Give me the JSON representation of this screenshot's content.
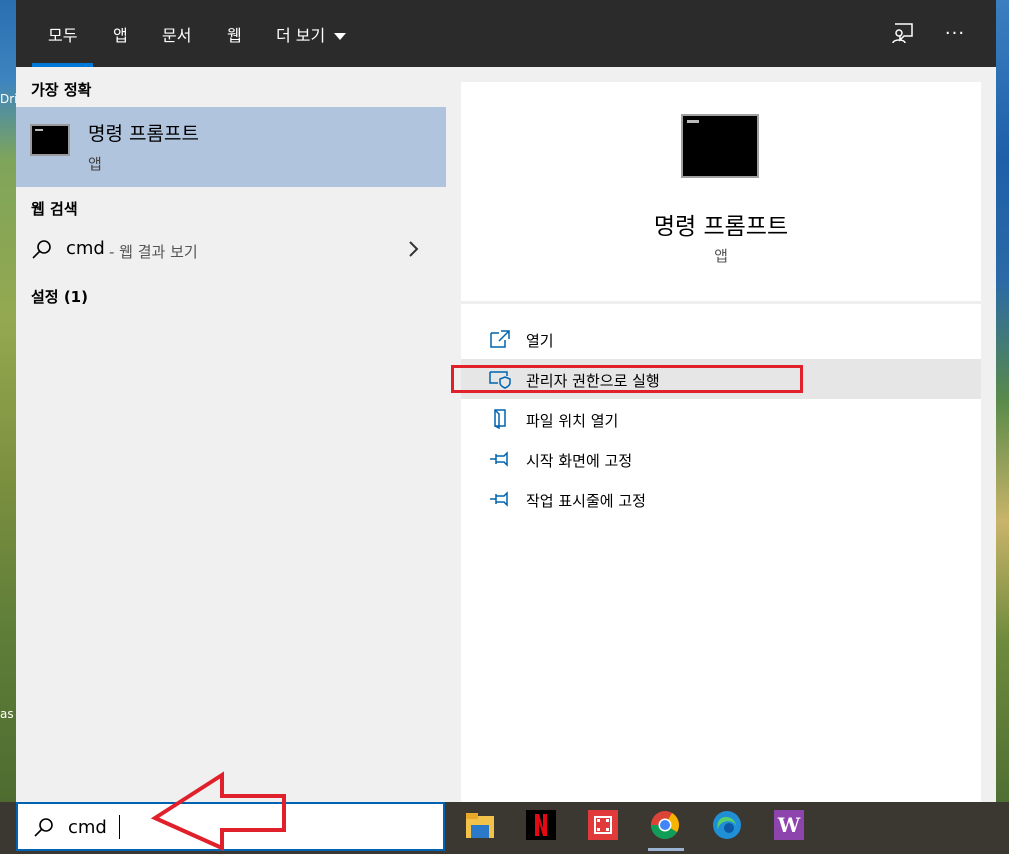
{
  "desktop": {
    "left_text_1": "Dri",
    "left_text_2": "as"
  },
  "tabs": [
    {
      "label": "모두",
      "active": true
    },
    {
      "label": "앱"
    },
    {
      "label": "문서"
    },
    {
      "label": "웹"
    },
    {
      "label": "더 보기"
    }
  ],
  "toolbar": {
    "feedback_icon": "feedback-icon",
    "more_icon": "ellipsis-icon",
    "more_label": "···"
  },
  "left": {
    "best_match_title": "가장 정확",
    "best_match": {
      "title": "명령 프롬프트",
      "subtitle": "앱"
    },
    "web_title": "웹 검색",
    "web_result": {
      "query": "cmd",
      "suffix": "- 웹 결과 보기"
    },
    "settings_title": "설정 (1)"
  },
  "right": {
    "title": "명령 프롬프트",
    "subtitle": "앱",
    "actions": [
      {
        "label": "열기",
        "icon": "open-icon"
      },
      {
        "label": "관리자 권한으로 실행",
        "icon": "shield-icon",
        "highlighted": true
      },
      {
        "label": "파일 위치 열기",
        "icon": "file-location-icon"
      },
      {
        "label": "시작 화면에 고정",
        "icon": "pin-icon"
      },
      {
        "label": "작업 표시줄에 고정",
        "icon": "pin-icon"
      }
    ]
  },
  "search": {
    "value": "cmd",
    "icon": "search-icon"
  },
  "taskbar_apps": [
    "file-explorer-icon",
    "netflix-icon",
    "video-editor-icon",
    "chrome-icon",
    "edge-icon",
    "w-app-icon"
  ],
  "colors": {
    "accent": "#0078d7",
    "highlight": "#e0202a",
    "selected": "#b0c4de",
    "topbar": "#2b2b2b"
  }
}
